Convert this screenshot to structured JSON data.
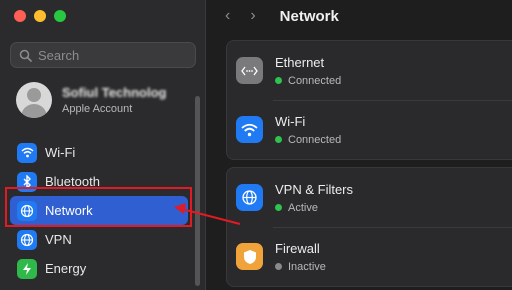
{
  "search": {
    "placeholder": "Search"
  },
  "account": {
    "name": "Sofiul Technolog",
    "subtitle": "Apple Account"
  },
  "sidebar": {
    "items": [
      {
        "label": "Wi-Fi",
        "icon": "wifi-icon",
        "color": "#1f7af3"
      },
      {
        "label": "Bluetooth",
        "icon": "bluetooth-icon",
        "color": "#1f7af3"
      },
      {
        "label": "Network",
        "icon": "globe-icon",
        "color": "#1f7af3",
        "selected": true
      },
      {
        "label": "VPN",
        "icon": "globe-icon",
        "color": "#1f7af3"
      },
      {
        "label": "Energy",
        "icon": "bolt-icon",
        "color": "#2fb94a"
      }
    ]
  },
  "header": {
    "title": "Network",
    "back": "‹",
    "forward": "›"
  },
  "main": {
    "group1": [
      {
        "title": "Ethernet",
        "status": "Connected",
        "status_color": "#2ec24e",
        "icon": "ethernet-icon"
      },
      {
        "title": "Wi-Fi",
        "status": "Connected",
        "status_color": "#2ec24e",
        "icon": "wifi-icon"
      }
    ],
    "group2": [
      {
        "title": "VPN & Filters",
        "status": "Active",
        "status_color": "#2ec24e",
        "icon": "globe-icon"
      },
      {
        "title": "Firewall",
        "status": "Inactive",
        "status_color": "#8a8a8a",
        "icon": "shield-icon"
      }
    ]
  },
  "annotation": {
    "color": "#e01b24"
  }
}
